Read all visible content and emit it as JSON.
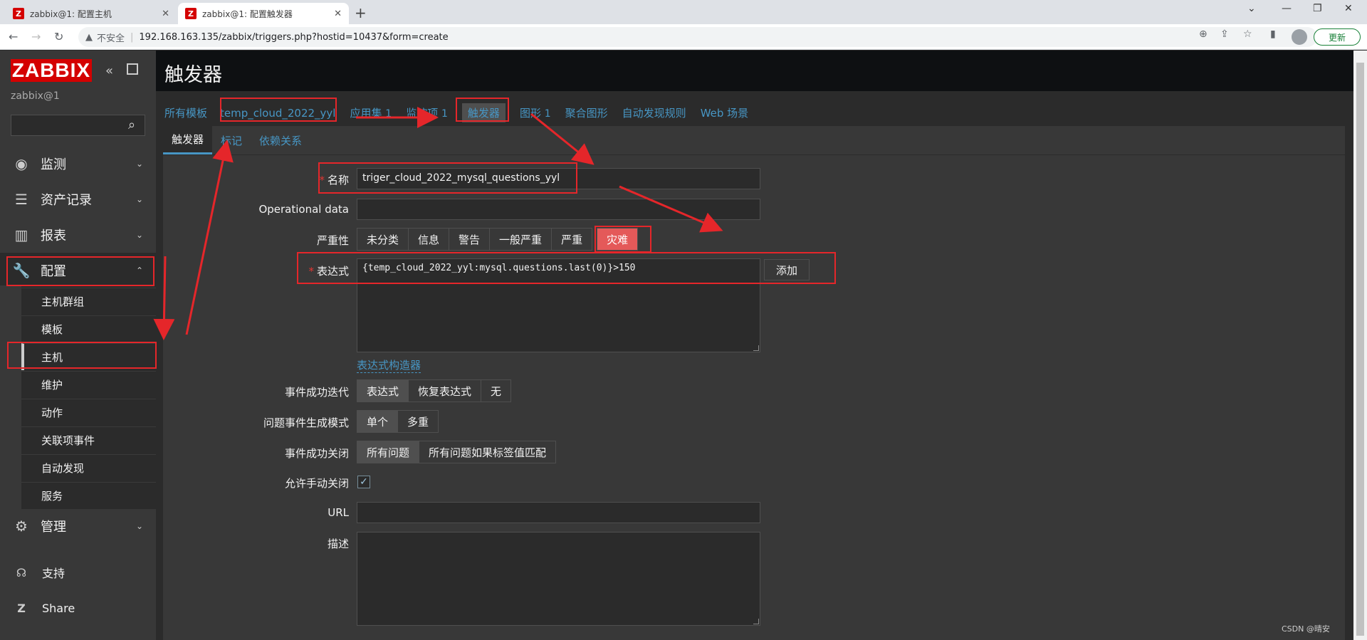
{
  "browser": {
    "tabs": [
      {
        "favicon": "Z",
        "title": "zabbix@1: 配置主机"
      },
      {
        "favicon": "Z",
        "title": "zabbix@1: 配置触发器"
      }
    ],
    "insecure_label": "不安全",
    "url": "192.168.163.135/zabbix/triggers.php?hostid=10437&form=create",
    "update_label": "更新"
  },
  "sidebar": {
    "logo": "ZABBIX",
    "server_name": "zabbix@1",
    "menu": [
      {
        "label": "监测",
        "icon": "eye-icon"
      },
      {
        "label": "资产记录",
        "icon": "list-icon"
      },
      {
        "label": "报表",
        "icon": "chart-icon"
      },
      {
        "label": "配置",
        "icon": "wrench-icon"
      }
    ],
    "submenu": [
      "主机群组",
      "模板",
      "主机",
      "维护",
      "动作",
      "关联项事件",
      "自动发现",
      "服务"
    ],
    "admin": "管理",
    "support": "支持",
    "share": "Share"
  },
  "header": {
    "title": "触发器"
  },
  "breadcrumb": {
    "all_templates": "所有模板",
    "host": "temp_cloud_2022_yyl",
    "applications": "应用集",
    "applications_count": "1",
    "items": "监控项",
    "items_count": "1",
    "triggers": "触发器",
    "graphs": "图形",
    "graphs_count": "1",
    "screens": "聚合图形",
    "discovery": "自动发现规则",
    "web": "Web 场景"
  },
  "subtabs": [
    "触发器",
    "标记",
    "依赖关系"
  ],
  "form": {
    "name_label": "名称",
    "name_value": "triger_cloud_2022_mysql_questions_yyl",
    "opdata_label": "Operational data",
    "opdata_value": "",
    "severity_label": "严重性",
    "severity_options": [
      "未分类",
      "信息",
      "警告",
      "一般严重",
      "严重",
      "灾难"
    ],
    "expression_label": "表达式",
    "expression_value": "{temp_cloud_2022_yyl:mysql.questions.last(0)}>150",
    "add_label": "添加",
    "constructor_label": "表达式构造器",
    "ok_event_label": "事件成功迭代",
    "ok_event_options": [
      "表达式",
      "恢复表达式",
      "无"
    ],
    "problem_mode_label": "问题事件生成模式",
    "problem_mode_options": [
      "单个",
      "多重"
    ],
    "ok_close_label": "事件成功关闭",
    "ok_close_options": [
      "所有问题",
      "所有问题如果标签值匹配"
    ],
    "manual_close_label": "允许手动关闭",
    "manual_close_checked": true,
    "url_label": "URL",
    "url_value": "",
    "desc_label": "描述",
    "desc_value": ""
  },
  "watermark": "CSDN @晴安"
}
